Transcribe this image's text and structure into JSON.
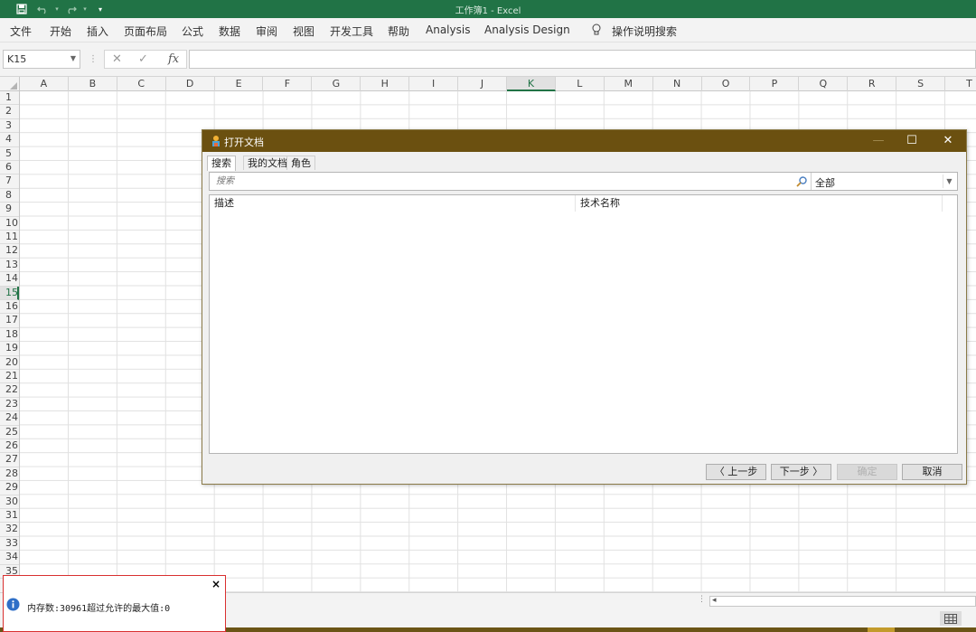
{
  "window": {
    "title": "工作簿1 - Excel",
    "accent": "#217346"
  },
  "ribbon": {
    "tabs": [
      "文件",
      "开始",
      "插入",
      "页面布局",
      "公式",
      "数据",
      "审阅",
      "视图",
      "开发工具",
      "帮助",
      "Analysis",
      "Analysis Design"
    ],
    "tell_me": "操作说明搜索"
  },
  "formula_bar": {
    "name_box": "K15",
    "fx": "fx",
    "cancel": "✕",
    "enter": "✓",
    "formula": ""
  },
  "sheet": {
    "columns": [
      "A",
      "B",
      "C",
      "D",
      "E",
      "F",
      "G",
      "H",
      "I",
      "J",
      "K",
      "L",
      "M",
      "N",
      "O",
      "P",
      "Q",
      "R",
      "S",
      "T"
    ],
    "rows": [
      "1",
      "2",
      "3",
      "4",
      "5",
      "6",
      "7",
      "8",
      "9",
      "10",
      "11",
      "12",
      "13",
      "14",
      "15",
      "16",
      "17",
      "18",
      "19",
      "20",
      "21",
      "22",
      "23",
      "24",
      "25",
      "26",
      "27",
      "28",
      "29",
      "30",
      "31",
      "32",
      "33",
      "34",
      "35"
    ],
    "selected_cell": "K15"
  },
  "dialog": {
    "title": "打开文档",
    "title_color": "#6b5010",
    "controls": {
      "minimize": "—",
      "maximize": "☐",
      "close": "✕"
    },
    "tabs": [
      "搜索",
      "我的文档",
      "角色"
    ],
    "active_tab": "搜索",
    "search": {
      "placeholder": "搜索",
      "value": ""
    },
    "filter": {
      "selected": "全部"
    },
    "list_headers": [
      "描述",
      "技术名称"
    ],
    "buttons": {
      "prev": "〈 上一步",
      "next": "下一步 〉",
      "ok": "确定",
      "cancel": "取消"
    }
  },
  "notification": {
    "message": "内存数:30961超过允许的最大值:0",
    "close": "×",
    "icon": "info-icon",
    "border_color": "#d93030"
  }
}
